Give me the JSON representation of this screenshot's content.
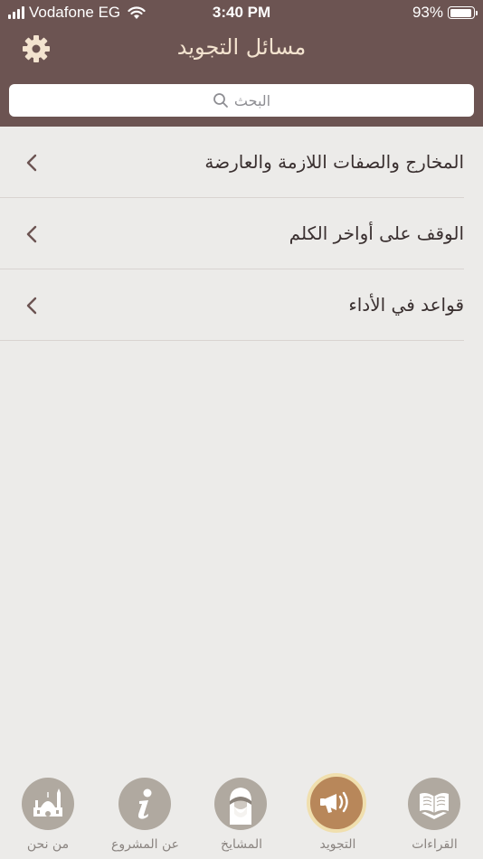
{
  "status_bar": {
    "carrier": "Vodafone EG",
    "time": "3:40 PM",
    "battery": "93%",
    "battery_level": 0.93
  },
  "nav": {
    "title": "مسائل التجويد",
    "settings_icon": "gear-icon"
  },
  "search": {
    "placeholder": "البحث"
  },
  "list": {
    "items": [
      {
        "label": "المخارج والصفات اللازمة والعارضة"
      },
      {
        "label": "الوقف على أواخر الكلم"
      },
      {
        "label": "قواعد في الأداء"
      }
    ]
  },
  "tabbar": {
    "items": [
      {
        "label": "من نحن",
        "icon": "mosque-icon",
        "selected": false
      },
      {
        "label": "عن المشروع",
        "icon": "info-icon",
        "selected": false
      },
      {
        "label": "المشايخ",
        "icon": "sheikh-icon",
        "selected": false
      },
      {
        "label": "التجويد",
        "icon": "megaphone-icon",
        "selected": true
      },
      {
        "label": "القراءات",
        "icon": "quran-icon",
        "selected": false
      }
    ]
  },
  "colors": {
    "header": "#6c5452",
    "title_text": "#f3e3cf",
    "background": "#ecebe9",
    "tab_inactive": "#b0a9a0",
    "tab_active": "#b8875a",
    "tab_active_ring": "#f0dfae",
    "chevron": "#6c5452"
  }
}
